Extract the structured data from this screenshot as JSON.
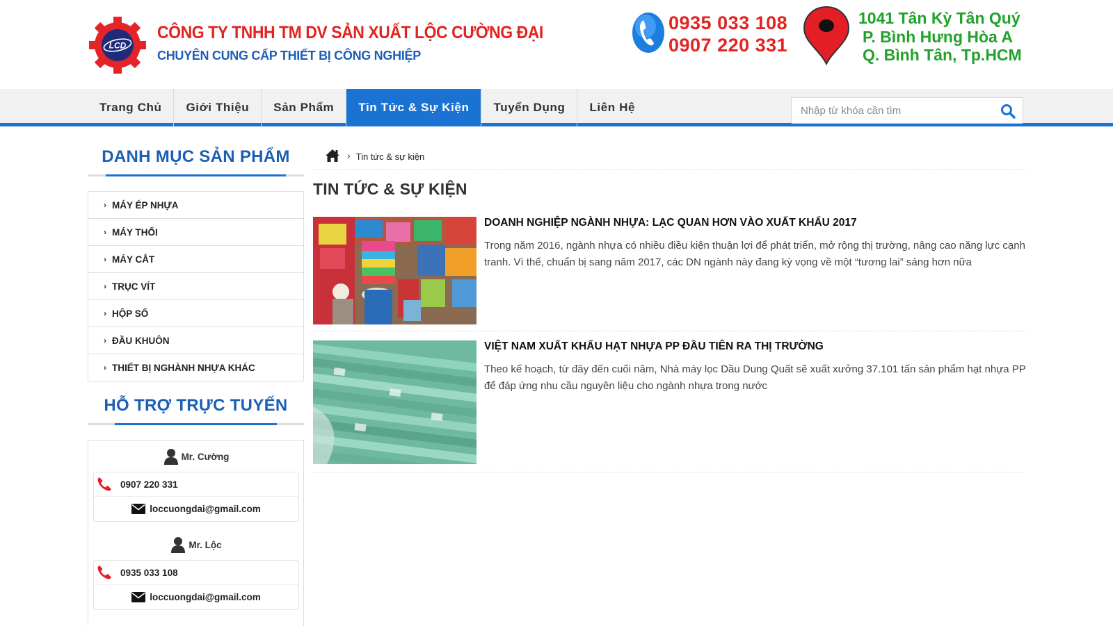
{
  "header": {
    "logo_text": "LCD",
    "company_name": "CÔNG TY TNHH TM DV SẢN XUẤT LỘC CƯỜNG ĐẠI",
    "tagline": "CHUYÊN CUNG CẤP THIẾT BỊ CÔNG NGHIỆP",
    "phones": [
      "0935 033 108",
      "0907 220 331"
    ],
    "address": [
      "1041 Tân Kỳ Tân Quý",
      "P. Bình Hưng Hòa A",
      "Q. Bình Tân, Tp.HCM"
    ]
  },
  "nav": {
    "items": [
      {
        "label": "Trang Chủ"
      },
      {
        "label": "Giới Thiệu"
      },
      {
        "label": "Sản Phẩm"
      },
      {
        "label": "Tin Tức & Sự Kiện",
        "active": true
      },
      {
        "label": "Tuyển Dụng"
      },
      {
        "label": "Liên Hệ"
      }
    ],
    "search_placeholder": "Nhập từ khóa cần tìm"
  },
  "sidebar": {
    "categories_heading": "DANH MỤC SẢN PHẨM",
    "categories": [
      "MÁY ÉP NHỰA",
      "MÁY THỔI",
      "MÁY CẮT",
      "TRỤC VÍT",
      "HỘP SỐ",
      "ĐẦU KHUÔN",
      "THIẾT BỊ NGHÀNH NHỰA KHÁC"
    ],
    "support_heading": "HỖ TRỢ TRỰC TUYẾN",
    "contacts": [
      {
        "name": "Mr. Cường",
        "phone": "0907 220 331",
        "email": "loccuongdai@gmail.com"
      },
      {
        "name": "Mr. Lộc",
        "phone": "0935 033 108",
        "email": "loccuongdai@gmail.com"
      }
    ]
  },
  "breadcrumb": {
    "current": "Tin tức & sự kiện"
  },
  "main": {
    "title": "TIN TỨC & SỰ KIỆN",
    "articles": [
      {
        "title": "DOANH NGHIỆP NGÀNH NHỰA: LẠC QUAN HƠN VÀO XUẤT KHẨU 2017",
        "description": "Trong năm 2016, ngành nhựa có nhiều điều kiện thuận lợi để phát triển, mở rộng thị trường, nâng cao năng lực cạnh tranh. Vì thế, chuẩn bị sang năm 2017, các DN ngành này đang kỳ vọng về một “tương lai” sáng hơn nữa"
      },
      {
        "title": "VIỆT NAM XUẤT KHẨU HẠT NHỰA PP ĐẦU TIÊN RA THỊ TRƯỜNG",
        "description": "Theo kế hoạch, từ đây đến cuối năm, Nhà máy lọc Dầu Dung Quất sẽ xuất xưởng 37.101 tấn sản phẩm hạt nhựa PP để đáp ứng nhu cầu nguyên liệu cho ngành nhựa trong nước"
      }
    ]
  },
  "colors": {
    "brand_red": "#e32320",
    "brand_blue": "#1a73d3",
    "address_green": "#22a22a"
  }
}
